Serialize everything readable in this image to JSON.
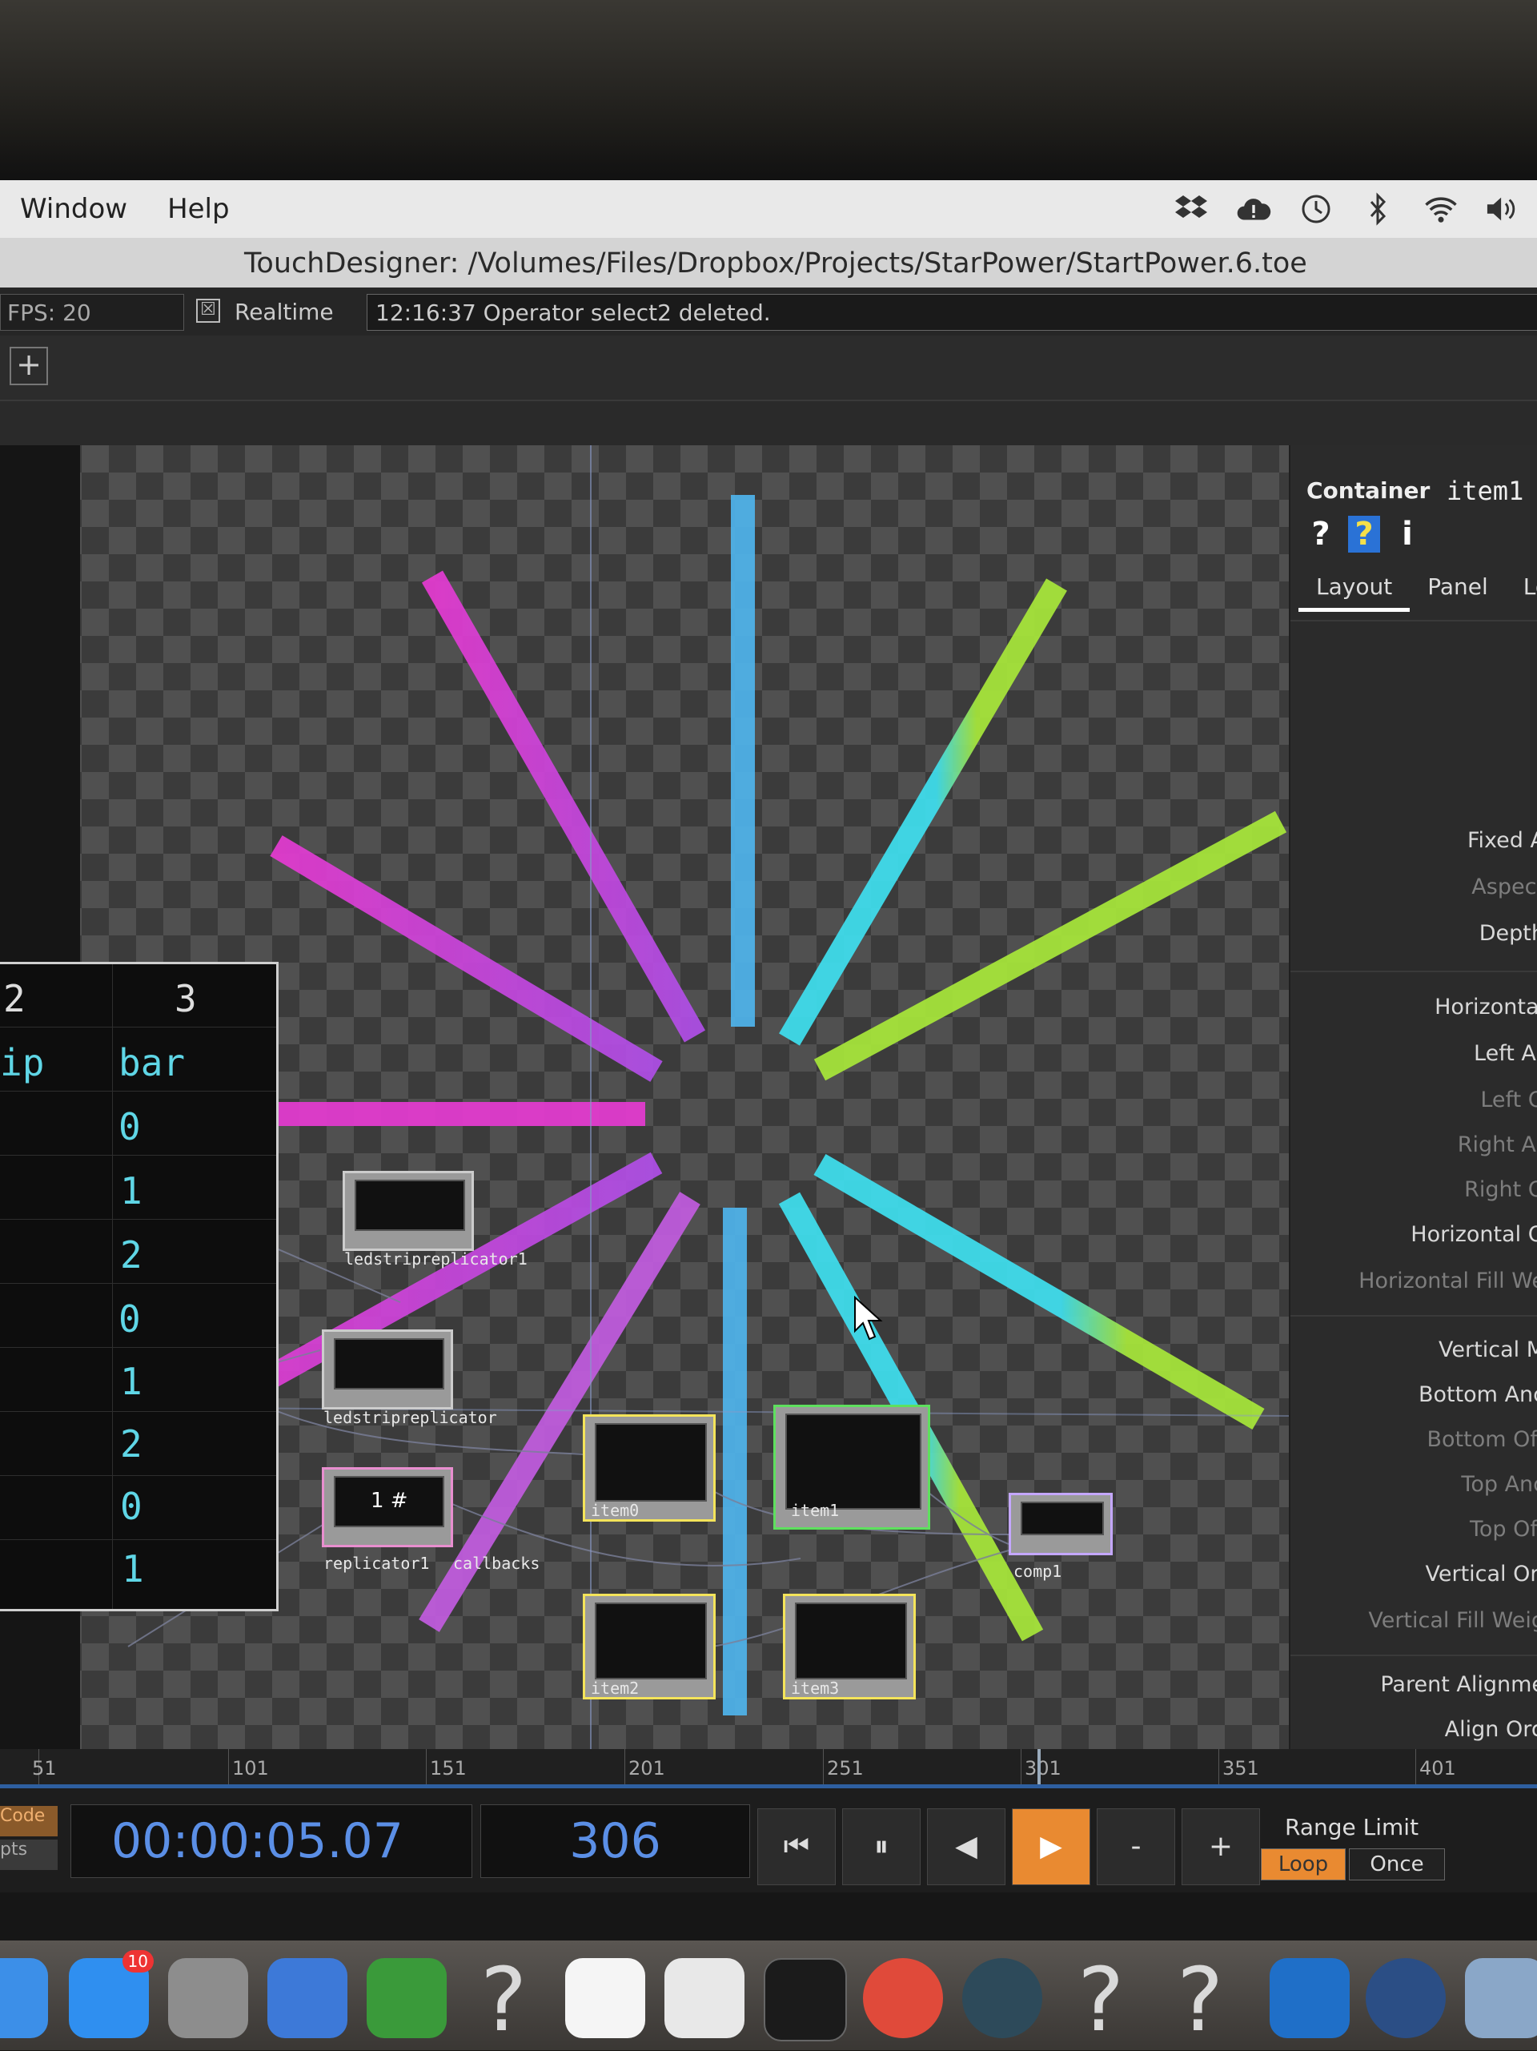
{
  "menubar": {
    "items": [
      "Window",
      "Help"
    ],
    "tray_icons": [
      "dropbox-icon",
      "cloud-alert-icon",
      "time-machine-icon",
      "bluetooth-icon",
      "wifi-icon",
      "volume-icon"
    ]
  },
  "titlebar": {
    "title": "TouchDesigner: /Volumes/Files/Dropbox/Projects/StarPower/StartPower.6.toe"
  },
  "status": {
    "fps_label": "FPS:  20",
    "realtime_checkbox": "☒",
    "realtime_label": "Realtime",
    "message": "12:16:37 Operator select2 deleted."
  },
  "toolbar": {
    "add_label": "+"
  },
  "table_op": {
    "headers": [
      "2",
      "3"
    ],
    "col_names": [
      "ip",
      "bar"
    ],
    "bar_values": [
      "0",
      "1",
      "2",
      "0",
      "1",
      "2",
      "0",
      "1"
    ]
  },
  "nodes": {
    "ledstripreplicator1": "ledstripreplicator1",
    "ledstripreplicator": "ledstripreplicator",
    "replicator1": "replicator1",
    "callbacks": "callbacks",
    "callbacks_text": "1 #",
    "item0": "item0",
    "item1": "item1",
    "item2": "item2",
    "item3": "item3",
    "comp1": "comp1"
  },
  "params": {
    "type": "Container",
    "name": "item1",
    "icons": [
      "?",
      "?",
      "i"
    ],
    "tabs": [
      "Layout",
      "Panel",
      "Loc"
    ],
    "rows": [
      {
        "label": "Fixed A",
        "dim": false
      },
      {
        "label": "Aspect",
        "dim": true
      },
      {
        "label": "Depth",
        "dim": false
      },
      {
        "label": "Horizontal",
        "dim": false
      },
      {
        "label": "Left Ar",
        "dim": false
      },
      {
        "label": "Left O",
        "dim": true
      },
      {
        "label": "Right Ar",
        "dim": true
      },
      {
        "label": "Right O",
        "dim": true
      },
      {
        "label": "Horizontal O",
        "dim": false
      },
      {
        "label": "Horizontal Fill We",
        "dim": true
      },
      {
        "label": "Vertical M",
        "dim": false
      },
      {
        "label": "Bottom Anc",
        "dim": false
      },
      {
        "label": "Bottom Off",
        "dim": true
      },
      {
        "label": "Top Anc",
        "dim": true
      },
      {
        "label": "Top Off",
        "dim": true
      },
      {
        "label": "Vertical Ori",
        "dim": false
      },
      {
        "label": "Vertical Fill Weig",
        "dim": true
      },
      {
        "label": "Parent Alignme",
        "dim": false
      },
      {
        "label": "Align Ord",
        "dim": false
      }
    ]
  },
  "ruler": {
    "ticks": [
      "51",
      "101",
      "151",
      "201",
      "251",
      "301",
      "351",
      "401"
    ]
  },
  "timeline": {
    "code_label": "Code",
    "pts_label": "pts",
    "timecode": "00:00:05.07",
    "frame": "306",
    "buttons": [
      "⏮",
      "⏸",
      "◀",
      "▶",
      "-",
      "+"
    ],
    "range_limit_label": "Range Limit",
    "loop_label": "Loop",
    "once_label": "Once"
  },
  "dock": {
    "icons": [
      "finder-icon",
      "app-store-icon",
      "system-preferences-icon",
      "word-icon",
      "sourcetree-icon",
      "unknown-app-icon",
      "photos-icon",
      "slack-icon",
      "terminal-icon",
      "chrome-icon",
      "touchdesigner-icon",
      "unknown-app-icon",
      "unknown-app-icon",
      "vscode-icon",
      "quicktime-icon",
      "preview-icon"
    ],
    "app_store_badge": "10",
    "unknown_glyph": "?"
  },
  "colors": {
    "magenta": "#e63bd2",
    "violet": "#9a6cf0",
    "sky": "#4fb4ec",
    "cyan": "#3fe0f0",
    "lime": "#a8e83a",
    "timeline_orange": "#e98a31",
    "timecode_blue": "#5b8fe6"
  }
}
